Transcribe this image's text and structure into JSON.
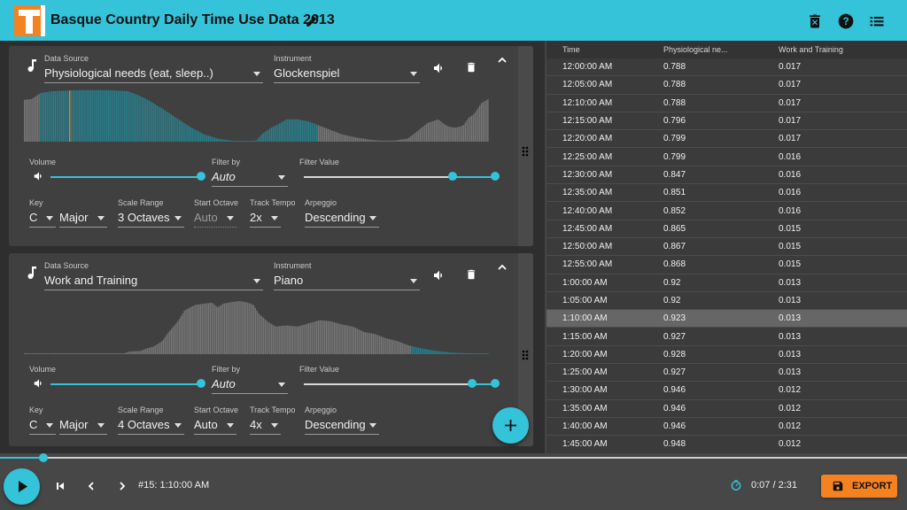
{
  "app": {
    "title": "Basque Country Daily Time Use Data 2013",
    "colors": {
      "accent": "#34c3d9",
      "logo": "#f58220",
      "export": "#f58220",
      "played_bar": "#2a7f8c",
      "cursor_bar": "#f58220",
      "bar": "#777777"
    },
    "toolbar": {
      "icons": [
        "edit-icon",
        "delete-all-icon",
        "help-icon",
        "list-icon"
      ]
    }
  },
  "tracks": [
    {
      "data_source_label": "Data Source",
      "data_source": "Physiological needs (eat, sleep..)",
      "instrument_label": "Instrument",
      "instrument": "Glockenspiel",
      "volume_label": "Volume",
      "volume": 1.0,
      "filter_by_label": "Filter by",
      "filter_by": "Auto",
      "filter_value_label": "Filter Value",
      "filter_range": [
        0.78,
        1.0
      ],
      "key_label": "Key",
      "key": "C",
      "mode": "Major",
      "scale_range_label": "Scale Range",
      "scale_range": "3 Octaves",
      "start_octave_label": "Start Octave",
      "start_octave": "Auto",
      "start_octave_disabled": true,
      "tempo_label": "Track Tempo",
      "tempo": "2x",
      "arpeggio_label": "Arpeggio",
      "arpeggio": "Descending",
      "waveform": {
        "points": [
          [
            0,
            0.79
          ],
          [
            5,
            0.8
          ],
          [
            12,
            0.92
          ],
          [
            20,
            0.95
          ],
          [
            40,
            0.97
          ],
          [
            60,
            0.97
          ],
          [
            75,
            0.95
          ],
          [
            82,
            0.88
          ],
          [
            90,
            0.78
          ],
          [
            100,
            0.62
          ],
          [
            110,
            0.45
          ],
          [
            120,
            0.28
          ],
          [
            130,
            0.14
          ],
          [
            140,
            0.06
          ],
          [
            150,
            0.02
          ],
          [
            160,
            0.01
          ],
          [
            168,
            0.02
          ],
          [
            172,
            0.14
          ],
          [
            178,
            0.25
          ],
          [
            184,
            0.33
          ],
          [
            190,
            0.42
          ],
          [
            198,
            0.42
          ],
          [
            206,
            0.38
          ],
          [
            214,
            0.3
          ],
          [
            222,
            0.22
          ],
          [
            230,
            0.14
          ],
          [
            240,
            0.08
          ],
          [
            250,
            0.04
          ],
          [
            258,
            0.02
          ],
          [
            268,
            0.02
          ],
          [
            278,
            0.06
          ],
          [
            285,
            0.2
          ],
          [
            292,
            0.35
          ],
          [
            300,
            0.42
          ],
          [
            306,
            0.3
          ],
          [
            312,
            0.26
          ],
          [
            318,
            0.3
          ],
          [
            322,
            0.45
          ],
          [
            326,
            0.52
          ],
          [
            331,
            0.72
          ],
          [
            336,
            0.8
          ]
        ],
        "count": 288,
        "played_range": [
          5,
          90
        ],
        "cursor_index": 14,
        "filter_threshold": 0.78
      }
    },
    {
      "data_source_label": "Data Source",
      "data_source": "Work and Training",
      "instrument_label": "Instrument",
      "instrument": "Piano",
      "volume_label": "Volume",
      "volume": 1.0,
      "filter_by_label": "Filter by",
      "filter_by": "Auto",
      "filter_value_label": "Filter Value",
      "filter_range": [
        0.88,
        1.0
      ],
      "key_label": "Key",
      "key": "C",
      "mode": "Major",
      "scale_range_label": "Scale Range",
      "scale_range": "4 Octaves",
      "start_octave_label": "Start Octave",
      "start_octave": "Auto",
      "start_octave_disabled": false,
      "tempo_label": "Track Tempo",
      "tempo": "4x",
      "arpeggio_label": "Arpeggio",
      "arpeggio": "Descending",
      "waveform": {
        "points": [
          [
            0,
            0.017
          ],
          [
            60,
            0.01
          ],
          [
            72,
            0.01
          ],
          [
            76,
            0.05
          ],
          [
            84,
            0.06
          ],
          [
            88,
            0.1
          ],
          [
            94,
            0.15
          ],
          [
            100,
            0.25
          ],
          [
            104,
            0.4
          ],
          [
            108,
            0.52
          ],
          [
            112,
            0.65
          ],
          [
            116,
            0.82
          ],
          [
            120,
            0.88
          ],
          [
            124,
            0.93
          ],
          [
            130,
            0.95
          ],
          [
            136,
            0.97
          ],
          [
            140,
            0.88
          ],
          [
            144,
            0.95
          ],
          [
            150,
            0.98
          ],
          [
            156,
            1.0
          ],
          [
            162,
            0.97
          ],
          [
            166,
            0.93
          ],
          [
            170,
            0.76
          ],
          [
            176,
            0.62
          ],
          [
            182,
            0.52
          ],
          [
            190,
            0.54
          ],
          [
            198,
            0.52
          ],
          [
            206,
            0.58
          ],
          [
            214,
            0.64
          ],
          [
            222,
            0.62
          ],
          [
            230,
            0.56
          ],
          [
            238,
            0.52
          ],
          [
            246,
            0.42
          ],
          [
            254,
            0.38
          ],
          [
            262,
            0.3
          ],
          [
            270,
            0.25
          ],
          [
            278,
            0.17
          ],
          [
            286,
            0.12
          ],
          [
            294,
            0.08
          ],
          [
            302,
            0.05
          ],
          [
            310,
            0.03
          ],
          [
            318,
            0.02
          ],
          [
            336,
            0.01
          ]
        ],
        "count": 288,
        "played_range": [
          120,
          168
        ],
        "cursor_index": -1,
        "filter_threshold": 0.88
      }
    }
  ],
  "table": {
    "columns": [
      "Time",
      "Physiological ne...",
      "Work and Training"
    ],
    "rows": [
      [
        "12:00:00 AM",
        "0.788",
        "0.017"
      ],
      [
        "12:05:00 AM",
        "0.788",
        "0.017"
      ],
      [
        "12:10:00 AM",
        "0.788",
        "0.017"
      ],
      [
        "12:15:00 AM",
        "0.796",
        "0.017"
      ],
      [
        "12:20:00 AM",
        "0.799",
        "0.017"
      ],
      [
        "12:25:00 AM",
        "0.799",
        "0.016"
      ],
      [
        "12:30:00 AM",
        "0.847",
        "0.016"
      ],
      [
        "12:35:00 AM",
        "0.851",
        "0.016"
      ],
      [
        "12:40:00 AM",
        "0.852",
        "0.016"
      ],
      [
        "12:45:00 AM",
        "0.865",
        "0.015"
      ],
      [
        "12:50:00 AM",
        "0.867",
        "0.015"
      ],
      [
        "12:55:00 AM",
        "0.868",
        "0.015"
      ],
      [
        "1:00:00 AM",
        "0.92",
        "0.013"
      ],
      [
        "1:05:00 AM",
        "0.92",
        "0.013"
      ],
      [
        "1:10:00 AM",
        "0.923",
        "0.013"
      ],
      [
        "1:15:00 AM",
        "0.927",
        "0.013"
      ],
      [
        "1:20:00 AM",
        "0.928",
        "0.013"
      ],
      [
        "1:25:00 AM",
        "0.927",
        "0.013"
      ],
      [
        "1:30:00 AM",
        "0.946",
        "0.012"
      ],
      [
        "1:35:00 AM",
        "0.946",
        "0.012"
      ],
      [
        "1:40:00 AM",
        "0.946",
        "0.012"
      ],
      [
        "1:45:00 AM",
        "0.948",
        "0.012"
      ]
    ],
    "selected_row": 14
  },
  "player": {
    "position_text": "#15: 1:10:00 AM",
    "time_text": "0:07 / 2:31",
    "progress": 0.048,
    "export_label": "EXPORT"
  }
}
